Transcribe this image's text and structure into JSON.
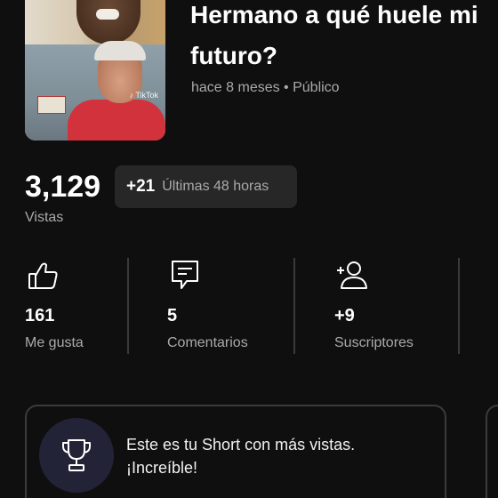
{
  "video": {
    "title": "Hermano a qué huele mi futuro?",
    "meta": "hace 8 meses • Público",
    "watermark": "TikTok"
  },
  "views": {
    "count": "3,129",
    "label": "Vistas",
    "delta_value": "+21",
    "delta_label": "Últimas 48 horas"
  },
  "stats": [
    {
      "icon": "thumbs-up-icon",
      "value": "161",
      "label": "Me gusta"
    },
    {
      "icon": "comment-icon",
      "value": "5",
      "label": "Comentarios"
    },
    {
      "icon": "add-subscriber-icon",
      "value": "+9",
      "label": "Suscriptores"
    }
  ],
  "achievement": {
    "icon": "trophy-icon",
    "line1": "Este es tu Short con más vistas.",
    "line2": "¡Increíble!"
  },
  "colors": {
    "background": "#0f0f0f",
    "primary_text": "#ffffff",
    "secondary_text": "#aaaaaa",
    "chip": "#272727",
    "trophy_circle": "#232337"
  }
}
